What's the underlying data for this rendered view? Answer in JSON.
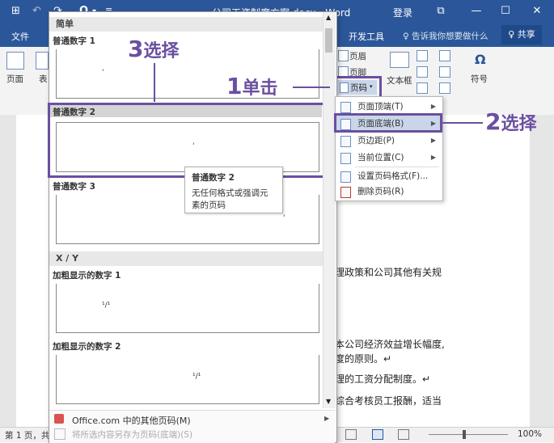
{
  "titlebar": {
    "quick_access": [
      "⊞",
      "↶",
      "↷",
      "O",
      "▾",
      "≡"
    ],
    "title": "公司工资制度方案.docx - Word",
    "login": "登录",
    "window_controls": [
      "⧉",
      "—",
      "☐",
      "✕"
    ]
  },
  "tabs": {
    "file": "文件",
    "developer": "开发工具",
    "tell_me": "♀ 告诉我你想要做什么",
    "share": "♀ 共享"
  },
  "ribbon": {
    "page_btn": "页面",
    "table_btn_partial": "表",
    "header_btn": "页眉",
    "footer_btn": "页脚",
    "page_number_btn": "页码",
    "textbox_btn": "文本框",
    "symbol_btn": "符号",
    "symbol_glyph": "Ω"
  },
  "document": {
    "lines": [
      "理政策和公司其他有关规",
      "本公司经济效益增长幅度,",
      "度的原则。↵",
      "理的工资分配制度。↵",
      "综合考核员工报酬，适当"
    ]
  },
  "statusbar": {
    "page_info": "第 1 页，共",
    "zoom": "100%"
  },
  "gallery": {
    "section_simple": "简单",
    "items": [
      {
        "label": "普通数字 1",
        "mark": "'"
      },
      {
        "label": "普通数字 2",
        "mark": "'"
      },
      {
        "label": "普通数字 3",
        "mark": "'"
      }
    ],
    "section_xy": "X / Y",
    "bold_items": [
      {
        "label": "加粗显示的数字 1",
        "mark": "¹/¹"
      },
      {
        "label": "加粗显示的数字 2",
        "mark": "¹/¹"
      }
    ],
    "footer_more": "Office.com 中的其他页码(M)",
    "footer_save": "将所选内容另存为页码(底端)(S)"
  },
  "tooltip": {
    "title": "普通数字 2",
    "body": "无任何格式或强调元素的页码"
  },
  "page_menu": {
    "items": [
      {
        "label": "页面顶端(T)",
        "submenu": true
      },
      {
        "label": "页面底端(B)",
        "submenu": true
      },
      {
        "label": "页边距(P)",
        "submenu": true
      },
      {
        "label": "当前位置(C)",
        "submenu": true
      },
      {
        "label": "设置页码格式(F)...",
        "submenu": false
      },
      {
        "label": "删除页码(R)",
        "submenu": false
      }
    ]
  },
  "annotations": {
    "step1_num": "1",
    "step1_text": "单击",
    "step2_num": "2",
    "step2_text": "选择",
    "step3_num": "3",
    "step3_text": "选择"
  },
  "colors": {
    "word_blue": "#2b579a",
    "annotation_purple": "#6b4fa0",
    "menu_highlight": "#c9d6ea"
  }
}
